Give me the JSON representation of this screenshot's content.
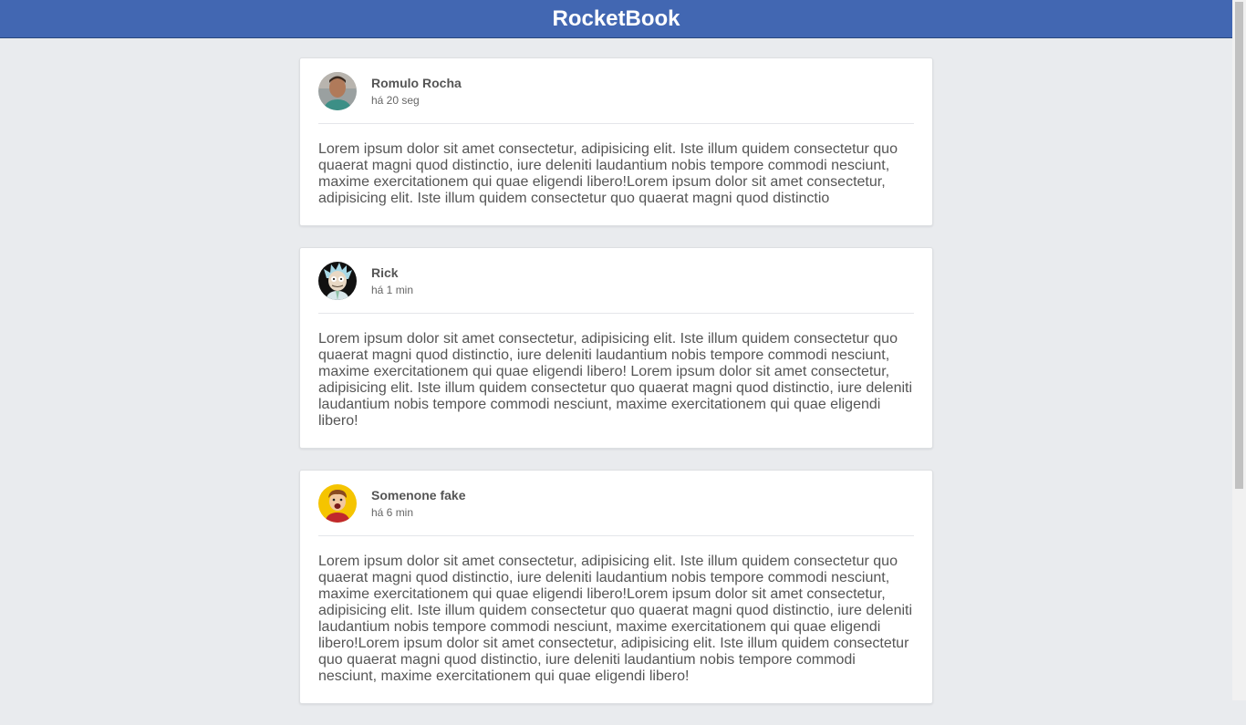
{
  "header": {
    "brand": "RocketBook",
    "color": "#4267b2"
  },
  "posts": [
    {
      "author": "Romulo Rocha",
      "time": "há 20 seg",
      "avatar_icon": "person-photo-avatar",
      "content": "Lorem ipsum dolor sit amet consectetur, adipisicing elit. Iste illum quidem consectetur quo quaerat magni quod distinctio, iure deleniti laudantium nobis tempore commodi nesciunt, maxime exercitationem qui quae eligendi libero!Lorem ipsum dolor sit amet consectetur, adipisicing elit. Iste illum quidem consectetur quo quaerat magni quod distinctio"
    },
    {
      "author": "Rick",
      "time": "há 1 min",
      "avatar_icon": "rick-cartoon-avatar",
      "content": "Lorem ipsum dolor sit amet consectetur, adipisicing elit. Iste illum quidem consectetur quo quaerat magni quod distinctio, iure deleniti laudantium nobis tempore commodi nesciunt, maxime exercitationem qui quae eligendi libero! Lorem ipsum dolor sit amet consectetur, adipisicing elit. Iste illum quidem consectetur quo quaerat magni quod distinctio, iure deleniti laudantium nobis tempore commodi nesciunt, maxime exercitationem qui quae eligendi libero!"
    },
    {
      "author": "Somenone fake",
      "time": "há 6 min",
      "avatar_icon": "cartoon-boy-avatar",
      "content": "Lorem ipsum dolor sit amet consectetur, adipisicing elit. Iste illum quidem consectetur quo quaerat magni quod distinctio, iure deleniti laudantium nobis tempore commodi nesciunt, maxime exercitationem qui quae eligendi libero!Lorem ipsum dolor sit amet consectetur, adipisicing elit. Iste illum quidem consectetur quo quaerat magni quod distinctio, iure deleniti laudantium nobis tempore commodi nesciunt, maxime exercitationem qui quae eligendi libero!Lorem ipsum dolor sit amet consectetur, adipisicing elit. Iste illum quidem consectetur quo quaerat magni quod distinctio, iure deleniti laudantium nobis tempore commodi nesciunt, maxime exercitationem qui quae eligendi libero!"
    }
  ]
}
